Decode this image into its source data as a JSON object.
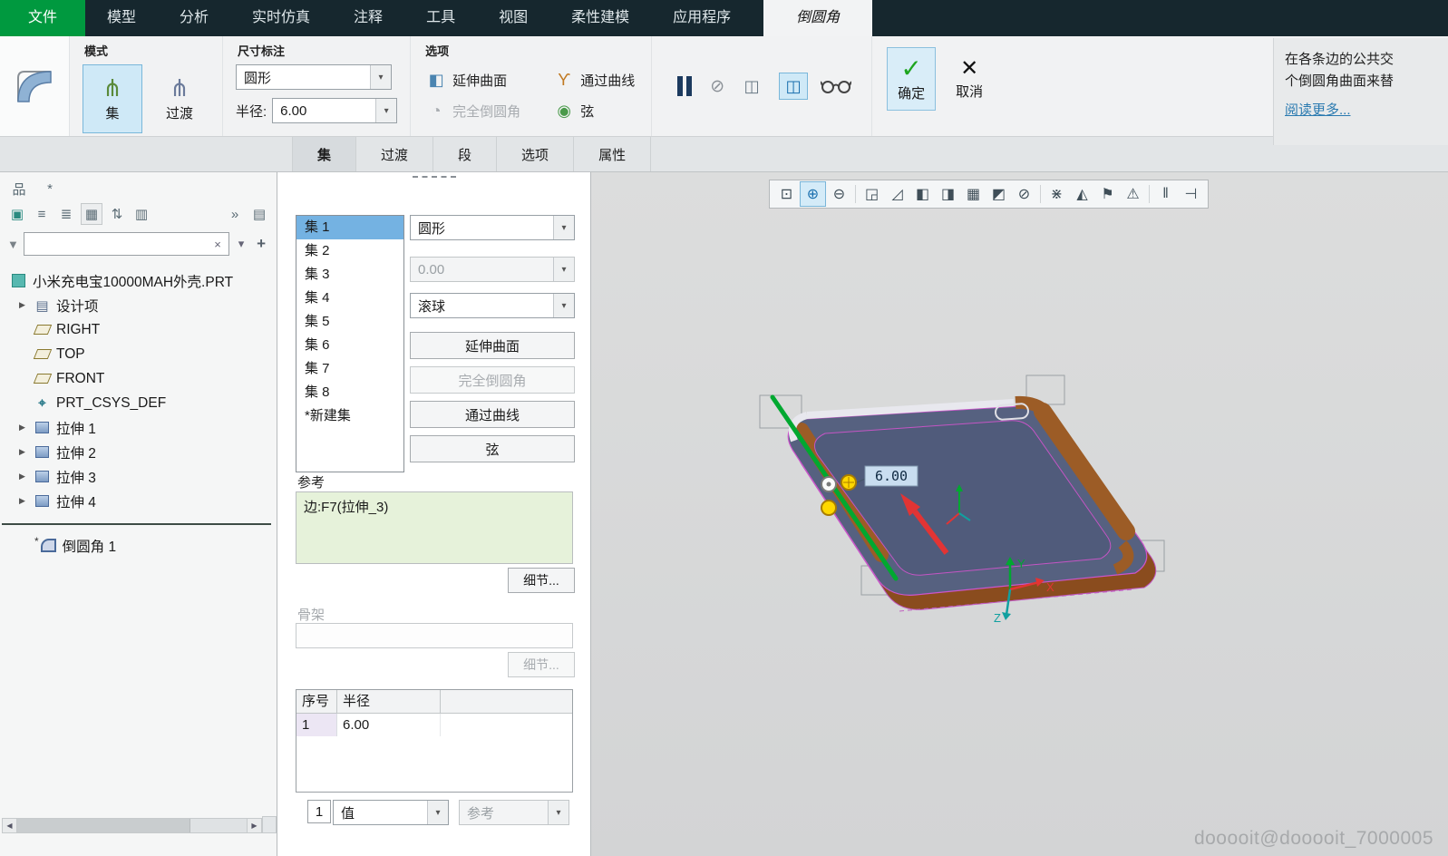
{
  "colors": {
    "file_tab_green": "#00993f",
    "menubar_bg": "#16272e",
    "selection_blue": "#cfe9f7",
    "ok_check_green": "#1ea51e",
    "reference_box_green": "#e6f2da",
    "model_face": "#566180",
    "fillet_preview_brown": "#9c5c26",
    "selected_edge_green": "#00a830",
    "direction_arrow_red": "#e23434",
    "edge_outline_magenta": "#cc55cc"
  },
  "menubar": {
    "items": [
      {
        "label": "文件"
      },
      {
        "label": "模型"
      },
      {
        "label": "分析"
      },
      {
        "label": "实时仿真"
      },
      {
        "label": "注释"
      },
      {
        "label": "工具"
      },
      {
        "label": "视图"
      },
      {
        "label": "柔性建模"
      },
      {
        "label": "应用程序"
      },
      {
        "label": "倒圆角"
      }
    ]
  },
  "ribbon": {
    "mode": {
      "label": "模式",
      "set": "集",
      "transition": "过渡"
    },
    "dimension": {
      "label": "尺寸标注",
      "shape": "圆形",
      "radius_label": "半径:",
      "radius": "6.00"
    },
    "options": {
      "label": "选项",
      "extend": "延伸曲面",
      "full_round": "完全倒圆角",
      "through_curve": "通过曲线",
      "chord": "弦"
    },
    "actions": {
      "ok": "确定",
      "cancel": "取消"
    },
    "help": {
      "line1": "在各条边的公共交",
      "line2": "个倒圆角曲面来替",
      "more": "阅读更多..."
    }
  },
  "tabrow": {
    "tabs": [
      {
        "label": "集"
      },
      {
        "label": "过渡"
      },
      {
        "label": "段"
      },
      {
        "label": "选项"
      },
      {
        "label": "属性"
      }
    ]
  },
  "tree": {
    "search": {
      "value": "",
      "placeholder": ""
    },
    "root": "小米充电宝10000MAH外壳.PRT",
    "items": [
      {
        "label": "设计项"
      },
      {
        "label": "RIGHT"
      },
      {
        "label": "TOP"
      },
      {
        "label": "FRONT"
      },
      {
        "label": "PRT_CSYS_DEF"
      },
      {
        "label": "拉伸 1"
      },
      {
        "label": "拉伸 2"
      },
      {
        "label": "拉伸 3"
      },
      {
        "label": "拉伸 4"
      },
      {
        "label": "倒圆角 1"
      }
    ]
  },
  "dashboard": {
    "sets": [
      {
        "label": "集 1"
      },
      {
        "label": "集 2"
      },
      {
        "label": "集 3"
      },
      {
        "label": "集 4"
      },
      {
        "label": "集 5"
      },
      {
        "label": "集 6"
      },
      {
        "label": "集 7"
      },
      {
        "label": "集 8"
      },
      {
        "label": "*新建集"
      }
    ],
    "shape_select": "圆形",
    "value_field": "0.00",
    "method_select": "滚球",
    "extend": "延伸曲面",
    "full_round": "完全倒圆角",
    "through_curve": "通过曲线",
    "chord": "弦",
    "ref_label": "参考",
    "ref_item": "边:F7(拉伸_3)",
    "details": "细节...",
    "spine_label": "骨架",
    "spine_details": "细节...",
    "table": {
      "headers": [
        {
          "label": "序号"
        },
        {
          "label": "半径"
        }
      ],
      "rows": [
        {
          "idx": "1",
          "radius": "6.00"
        }
      ]
    },
    "footer": {
      "count": "1",
      "value_mode": "值",
      "ref_mode": "参考"
    }
  },
  "canvas": {
    "dim_label": "6.00",
    "axes": {
      "y": "Y",
      "x": "X",
      "z": "Z"
    },
    "watermark": "dooooit@dooooit_7000005"
  },
  "icons": {
    "zoom_window": "⊡",
    "zoom_in": "⊕",
    "zoom_out": "⊖",
    "refit": "◲",
    "repaint": "◿",
    "display_style": "◧",
    "datum_display": "◨",
    "capture": "▦",
    "shaded": "◩",
    "suppress": "⊘",
    "axes": "⋇",
    "clip": "◭",
    "flag": "⚑",
    "warning": "⚠",
    "pause": "‖",
    "play_end": "⊣",
    "dropdown": "▾",
    "clear": "×",
    "add": "+",
    "overflow": "»",
    "expand": "▶",
    "filter": "▼",
    "mode_set": "⋔",
    "mode_transition": "⋔",
    "extend_surface": "◧",
    "full_round": "◔",
    "through_curve": "ϒ",
    "chord": "◉",
    "no_preview": "⊘",
    "preview_attach": "◫",
    "preview_connect": "◫",
    "ok_check": "✓",
    "cancel_x": "✕",
    "tree_toggle": "品",
    "favorites": "*",
    "cube": "▣",
    "list": "≡",
    "list2": "≣",
    "grid": "▦",
    "sort": "⇅",
    "columns": "▥",
    "panel": "▤",
    "scroll_left": "◀",
    "scroll_right": "▶"
  }
}
